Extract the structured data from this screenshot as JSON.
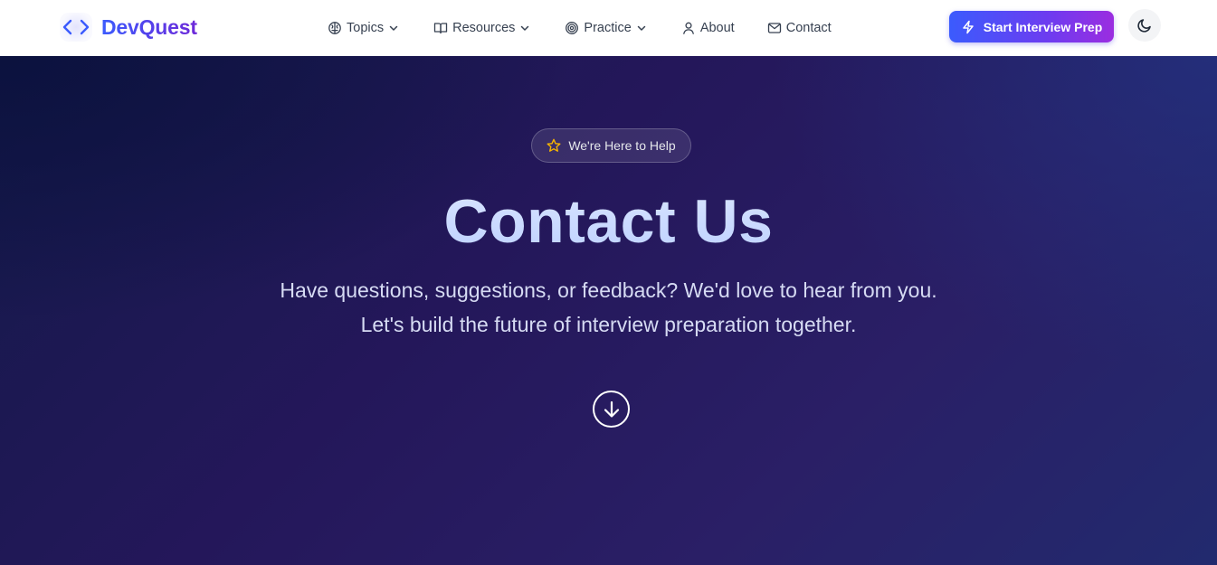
{
  "brand": {
    "name": "DevQuest",
    "logo_icon": "code-brackets-icon",
    "gradient_from": "#3b5bfd",
    "gradient_to": "#6d28d9"
  },
  "nav": {
    "items": [
      {
        "label": "Topics",
        "icon": "brain-icon",
        "has_dropdown": true
      },
      {
        "label": "Resources",
        "icon": "book-open-icon",
        "has_dropdown": true
      },
      {
        "label": "Practice",
        "icon": "target-icon",
        "has_dropdown": true
      },
      {
        "label": "About",
        "icon": "user-icon",
        "has_dropdown": false
      },
      {
        "label": "Contact",
        "icon": "mail-icon",
        "has_dropdown": false
      }
    ]
  },
  "cta": {
    "label": "Start Interview Prep",
    "icon": "lightning-icon"
  },
  "theme_toggle": {
    "icon": "moon-icon"
  },
  "hero": {
    "badge_label": "We're Here to Help",
    "badge_icon": "star-icon",
    "title": "Contact Us",
    "subtitle_line1": "Have questions, suggestions, or feedback? We'd love to hear from you.",
    "subtitle_line2": "Let's build the future of interview preparation together.",
    "scroll_icon": "arrow-down-circle-icon"
  },
  "colors": {
    "hero_bg": "#24175a",
    "title": "#c7d8ff",
    "star": "#f5b400"
  }
}
